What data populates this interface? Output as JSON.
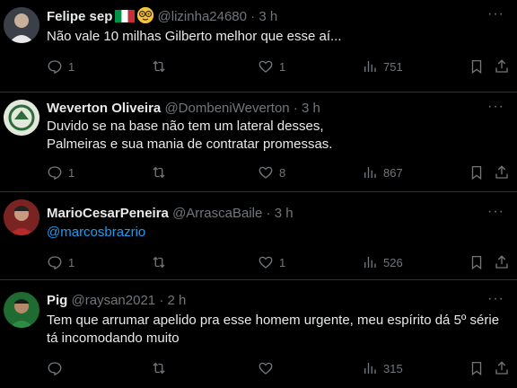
{
  "tweets": [
    {
      "name": "Felipe sep",
      "handle": "@lizinha24680",
      "dot": "·",
      "time": "3 h",
      "lines": [
        "Não vale 10 milhas Gilberto melhor que esse aí..."
      ],
      "replies": "1",
      "retweets": "",
      "likes": "1",
      "views": "751",
      "has_flag": true
    },
    {
      "name": "Weverton Oliveira",
      "handle": "@DombeniWeverton",
      "dot": "·",
      "time": "3 h",
      "lines": [
        "Duvido se na base não tem um lateral desses,",
        "Palmeiras e sua mania de contratar promessas."
      ],
      "replies": "1",
      "retweets": "",
      "likes": "8",
      "views": "867"
    },
    {
      "name": "MarioCesarPeneira",
      "handle": "@ArrascaBaile",
      "dot": "·",
      "time": "3 h",
      "lines": [
        "@marcosbrazrio"
      ],
      "replies": "1",
      "retweets": "",
      "likes": "1",
      "views": "526"
    },
    {
      "name": "Pig",
      "handle": "@raysan2021",
      "dot": "·",
      "time": "2 h",
      "lines": [
        "Tem que arrumar apelido pra esse homem urgente, meu espírito dá 5º série",
        "tá incomodando muito"
      ],
      "replies": "",
      "retweets": "",
      "likes": "",
      "views": "315"
    }
  ],
  "more_label": "···",
  "colors": {
    "background": "#000000",
    "text": "#e7e9ea",
    "muted": "#71767b",
    "link": "#1d9bf0",
    "divider": "#2f3336"
  }
}
